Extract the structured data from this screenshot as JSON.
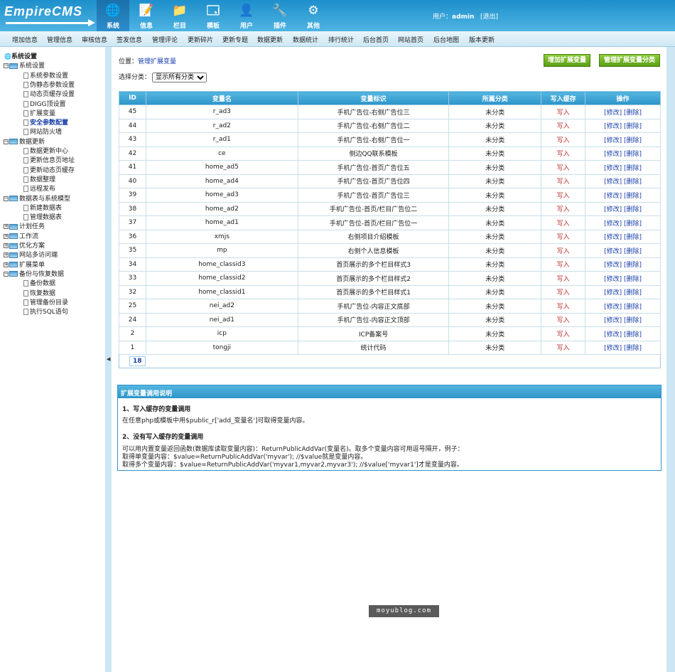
{
  "logo": "EmpireCMS",
  "nav": [
    {
      "label": "系统",
      "icon": "globe-icon",
      "glyph": "🌐"
    },
    {
      "label": "信息",
      "icon": "note-icon",
      "glyph": "📝"
    },
    {
      "label": "栏目",
      "icon": "folder-icon",
      "glyph": "📁"
    },
    {
      "label": "模板",
      "icon": "window-icon",
      "glyph": "🗔"
    },
    {
      "label": "用户",
      "icon": "user-icon",
      "glyph": "👤"
    },
    {
      "label": "插件",
      "icon": "tools-icon",
      "glyph": "🔧"
    },
    {
      "label": "其他",
      "icon": "gear-icon",
      "glyph": "⚙"
    }
  ],
  "user": {
    "prefix": "用户：",
    "name": "admin",
    "logout": "[退出]"
  },
  "menu": [
    "增加信息",
    "管理信息",
    "审核信息",
    "签发信息",
    "管理评论",
    "更新碎片",
    "更新专题",
    "数据更新",
    "数据统计",
    "排行统计",
    "后台首页",
    "网站首页",
    "后台地图",
    "版本更新"
  ],
  "tree": [
    {
      "label": "系统设置",
      "t": "root"
    },
    {
      "label": "系统设置",
      "t": "fold"
    },
    {
      "label": "系统参数设置",
      "t": "doc"
    },
    {
      "label": "伪静态参数设置",
      "t": "doc"
    },
    {
      "label": "动态页缓存设置",
      "t": "doc"
    },
    {
      "label": "DIGG顶设置",
      "t": "doc"
    },
    {
      "label": "扩展变量",
      "t": "doc"
    },
    {
      "label": "安全参数配置",
      "t": "doc",
      "sel": true
    },
    {
      "label": "网站防火墙",
      "t": "doc"
    },
    {
      "label": "数据更新",
      "t": "fold"
    },
    {
      "label": "数据更新中心",
      "t": "doc"
    },
    {
      "label": "更新信息页地址",
      "t": "doc"
    },
    {
      "label": "更新动态页缓存",
      "t": "doc"
    },
    {
      "label": "数据整理",
      "t": "doc"
    },
    {
      "label": "远程发布",
      "t": "doc"
    },
    {
      "label": "数据表与系统模型",
      "t": "fold"
    },
    {
      "label": "新建数据表",
      "t": "doc"
    },
    {
      "label": "管理数据表",
      "t": "doc"
    },
    {
      "label": "计划任务",
      "t": "closed"
    },
    {
      "label": "工作流",
      "t": "closed"
    },
    {
      "label": "优化方案",
      "t": "closed"
    },
    {
      "label": "网站多访问端",
      "t": "closed"
    },
    {
      "label": "扩展菜单",
      "t": "closed"
    },
    {
      "label": "备份与恢复数据",
      "t": "fold"
    },
    {
      "label": "备份数据",
      "t": "doc"
    },
    {
      "label": "恢复数据",
      "t": "doc"
    },
    {
      "label": "管理备份目录",
      "t": "doc"
    },
    {
      "label": "执行SQL语句",
      "t": "doc"
    }
  ],
  "main": {
    "location_prefix": "位置：",
    "location": "管理扩展变量",
    "btn_add": "增加扩展变量",
    "btn_manage": "管理扩展变量分类",
    "filter_label": "选择分类：",
    "filter_value": "显示所有分类",
    "headers": [
      "ID",
      "变量名",
      "变量标识",
      "所属分类",
      "写入缓存",
      "操作"
    ],
    "rows": [
      [
        "45",
        "r_ad3",
        "手机广告位-右侧广告位三"
      ],
      [
        "44",
        "r_ad2",
        "手机广告位-右侧广告位二"
      ],
      [
        "43",
        "r_ad1",
        "手机广告位-右侧广告位一"
      ],
      [
        "42",
        "ce",
        "侧边QQ联系模板"
      ],
      [
        "41",
        "home_ad5",
        "手机广告位-首页广告位五"
      ],
      [
        "40",
        "home_ad4",
        "手机广告位-首页广告位四"
      ],
      [
        "39",
        "home_ad3",
        "手机广告位-首页广告位三"
      ],
      [
        "38",
        "home_ad2",
        "手机广告位-首页/栏目广告位二"
      ],
      [
        "37",
        "home_ad1",
        "手机广告位-首页/栏目广告位一"
      ],
      [
        "36",
        "xmjs",
        "右侧项目介绍模板"
      ],
      [
        "35",
        "mp",
        "右侧个人信息模板"
      ],
      [
        "34",
        "home_classid3",
        "首页展示的多个栏目样式3"
      ],
      [
        "33",
        "home_classid2",
        "首页展示的多个栏目样式2"
      ],
      [
        "32",
        "home_classid1",
        "首页展示的多个栏目样式1"
      ],
      [
        "25",
        "nei_ad2",
        "手机广告位-内容正文底部"
      ],
      [
        "24",
        "nei_ad1",
        "手机广告位-内容正文顶部"
      ],
      [
        "2",
        "icp",
        "ICP备案号"
      ],
      [
        "1",
        "tongji",
        "统计代码"
      ]
    ],
    "category": "未分类",
    "write": "写入",
    "edit": "[修改]",
    "del": "[删除]",
    "total": "18"
  },
  "help": {
    "title": "扩展变量调用说明",
    "h1": "1、写入缓存的变量调用",
    "l1": "在任意php或模板中用$public_r['add_变量名']可取得变量内容。",
    "h2": "2、没有写入缓存的变量调用",
    "l2": "可以用内置变量返回函数(数据库读取变量内容)：ReturnPublicAddVar(变量名)。取多个变量内容可用逗号隔开，例子：",
    "l3": "取得单变量内容：$value=ReturnPublicAddVar('myvar'); //$value就是变量内容。",
    "l4": "取得多个变量内容：$value=ReturnPublicAddVar('myvar1,myvar2,myvar3'); //$value['myvar1']才是变量内容。"
  },
  "watermark": "moyublog.com"
}
